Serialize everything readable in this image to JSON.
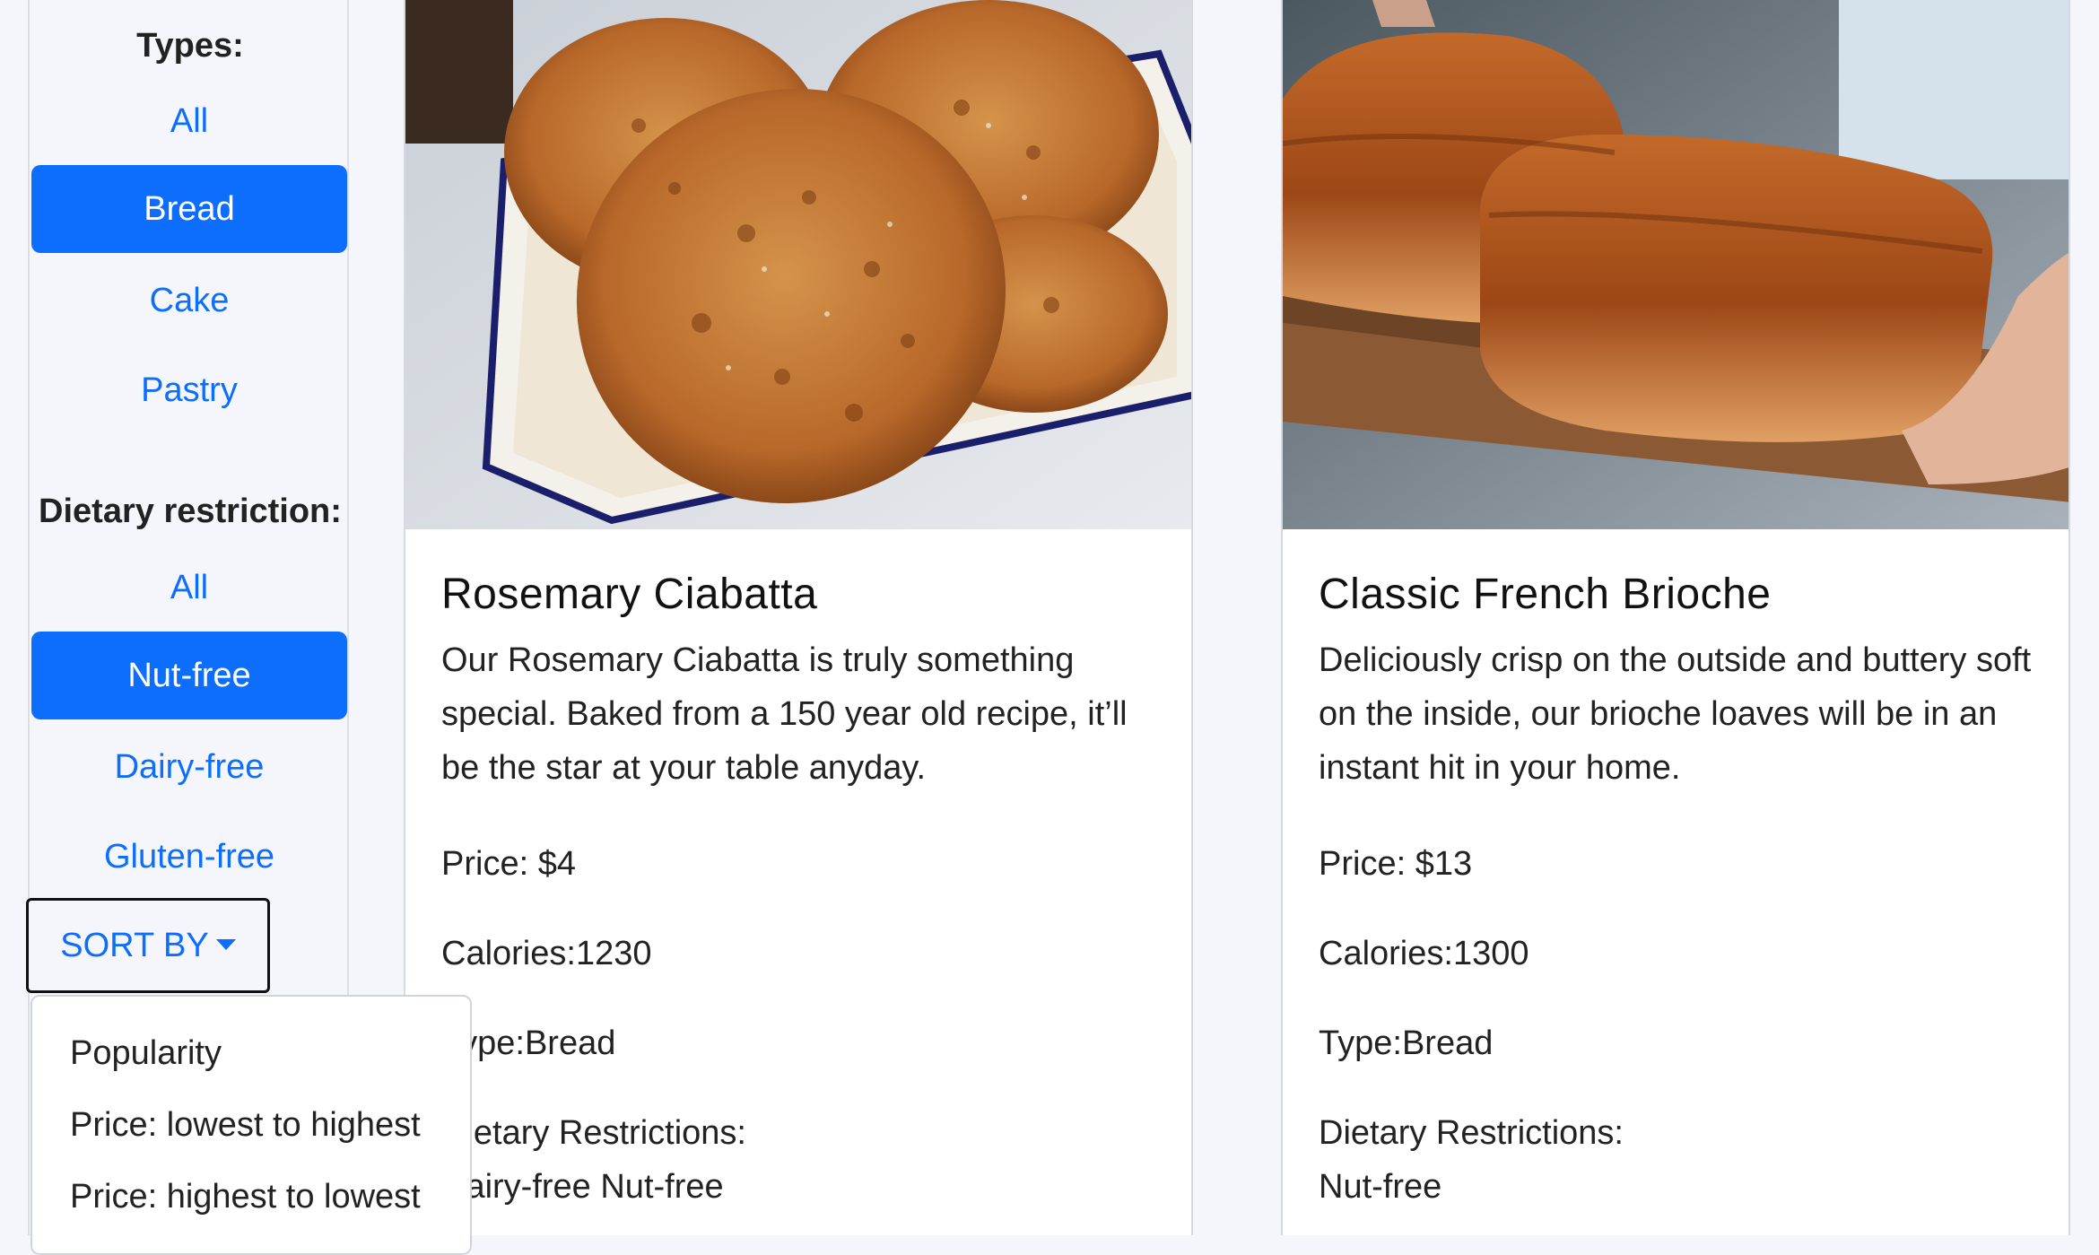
{
  "filters": {
    "types_heading": "Types:",
    "types": [
      {
        "label": "All",
        "active": false
      },
      {
        "label": "Bread",
        "active": true
      },
      {
        "label": "Cake",
        "active": false
      },
      {
        "label": "Pastry",
        "active": false
      }
    ],
    "dietary_heading": "Dietary restriction:",
    "dietary": [
      {
        "label": "All",
        "active": false
      },
      {
        "label": "Nut-free",
        "active": true
      },
      {
        "label": "Dairy-free",
        "active": false
      },
      {
        "label": "Gluten-free",
        "active": false
      }
    ]
  },
  "sort": {
    "button_label": "SORT BY",
    "options": [
      "Popularity",
      "Price: lowest to highest",
      "Price: highest to lowest"
    ]
  },
  "products": [
    {
      "name": "Rosemary Ciabatta",
      "description": "Our Rosemary Ciabatta is truly something special. Baked from a 150 year old recipe, it’ll be the star at your table anyday.",
      "price": "Price: $4",
      "calories": "Calories:1230",
      "type": "Type:Bread",
      "dietary_label": "Dietary Restrictions:",
      "dietary_values": "Dairy-free Nut-free"
    },
    {
      "name": "Classic French Brioche",
      "description": "Deliciously crisp on the outside and buttery soft on the inside, our brioche loaves will be in an instant hit in your home.",
      "price": "Price: $13",
      "calories": "Calories:1300",
      "type": "Type:Bread",
      "dietary_label": "Dietary Restrictions:",
      "dietary_values": "Nut-free"
    }
  ],
  "colors": {
    "accent": "#0d6efd",
    "page_background": "#f4f6fb"
  }
}
